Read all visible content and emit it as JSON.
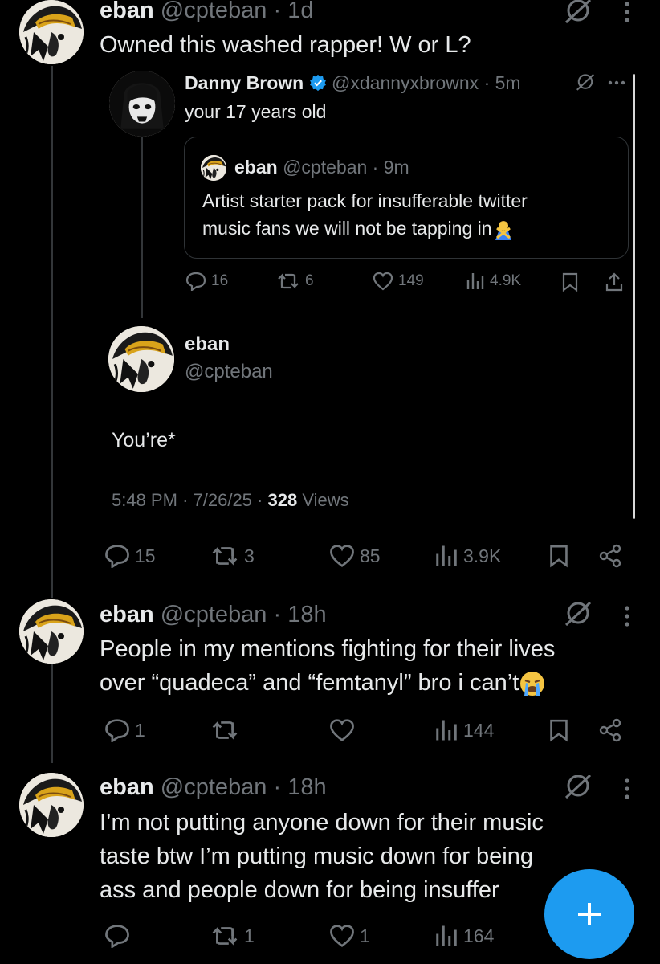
{
  "tweets": [
    {
      "name": "eban",
      "handle": "@cpteban",
      "sep": "·",
      "time": "1d",
      "text": "Owned this washed rapper! W or L?"
    },
    {
      "name": "eban",
      "handle": "@cpteban",
      "sep": "·",
      "time": "18h",
      "text_line1": "People in my mentions fighting for their lives",
      "text_line2": "over “quadeca” and “femtanyl” bro i can’t",
      "emoji": "crying-face-emoji",
      "replies": "1",
      "retweets": "",
      "likes": "",
      "views": "144"
    },
    {
      "name": "eban",
      "handle": "@cpteban",
      "sep": "·",
      "time": "18h",
      "text_line1": "I’m not putting anyone down for their music",
      "text_line2": "taste btw I’m putting music down for being",
      "text_line3": "ass and people down for being insuffer",
      "replies": "",
      "retweets": "1",
      "likes": "1",
      "views": "164"
    }
  ],
  "quoted": {
    "name": "Danny Brown",
    "verified": true,
    "handle": "@xdannyxbrownx",
    "sep": "·",
    "time": "5m",
    "text": "your 17 years old",
    "inner": {
      "name": "eban",
      "handle": "@cpteban",
      "sep": "·",
      "time": "9m",
      "text_line1": "Artist starter pack for insufferable twitter",
      "text_line2": "music fans we will not be tapping in",
      "emoji": "person-gesturing-no-emoji"
    },
    "replies": "16",
    "retweets": "6",
    "likes": "149",
    "views": "4.9K",
    "reply": {
      "name": "eban",
      "handle": "@cpteban",
      "text": "You’re*",
      "time": "5:48 PM",
      "date": "7/26/25",
      "views_count": "328",
      "views_label": "Views"
    }
  },
  "main_actions": {
    "replies": "15",
    "retweets": "3",
    "likes": "85",
    "views": "3.9K"
  },
  "icons": {
    "grok": "grok-icon",
    "more": "more-icon",
    "reply": "reply-icon",
    "retweet": "retweet-icon",
    "like": "like-icon",
    "views": "views-icon",
    "bookmark": "bookmark-icon",
    "share": "share-icon",
    "compose": "compose-plus-icon"
  },
  "colors": {
    "accent": "#1d9bf0",
    "muted": "#71767b",
    "text": "#e7e9ea",
    "background": "#000000"
  }
}
